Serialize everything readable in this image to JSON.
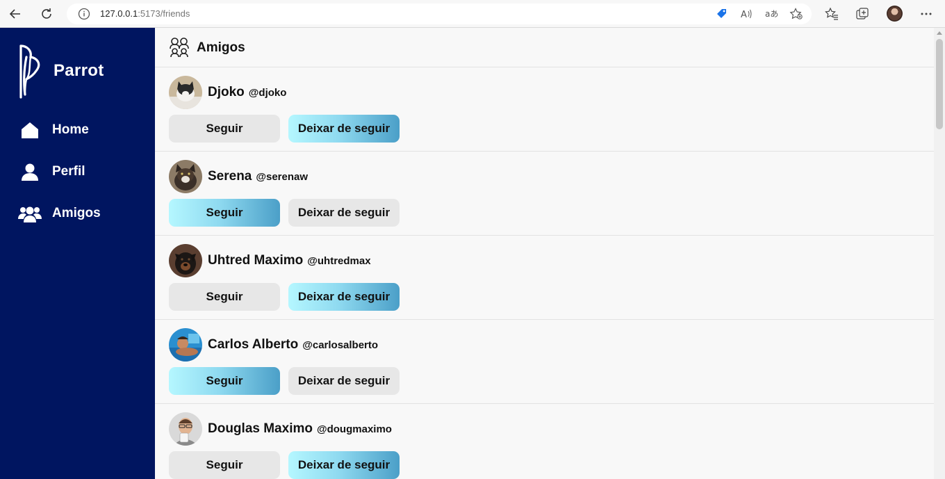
{
  "browser": {
    "url_host": "127.0.0.1",
    "url_path": ":5173/friends"
  },
  "sidebar": {
    "brand": "Parrot",
    "items": [
      {
        "label": "Home",
        "icon": "home-icon"
      },
      {
        "label": "Perfil",
        "icon": "user-icon"
      },
      {
        "label": "Amigos",
        "icon": "users-icon"
      }
    ]
  },
  "main": {
    "title": "Amigos",
    "friends": [
      {
        "name": "Djoko",
        "handle": "@djoko",
        "follow_label": "Seguir",
        "unfollow_label": "Deixar de seguir",
        "highlighted": "unfollow"
      },
      {
        "name": "Serena",
        "handle": "@serenaw",
        "follow_label": "Seguir",
        "unfollow_label": "Deixar de seguir",
        "highlighted": "follow"
      },
      {
        "name": "Uhtred Maximo",
        "handle": "@uhtredmax",
        "follow_label": "Seguir",
        "unfollow_label": "Deixar de seguir",
        "highlighted": "unfollow"
      },
      {
        "name": "Carlos Alberto",
        "handle": "@carlosalberto",
        "follow_label": "Seguir",
        "unfollow_label": "Deixar de seguir",
        "highlighted": "follow"
      },
      {
        "name": "Douglas Maximo",
        "handle": "@dougmaximo",
        "follow_label": "Seguir",
        "unfollow_label": "Deixar de seguir",
        "highlighted": "unfollow"
      }
    ]
  },
  "colors": {
    "sidebar_bg": "#001560",
    "button_gradient_start": "#b5f7ff",
    "button_gradient_end": "#4b9fc8",
    "button_grey": "#e7e7e7"
  }
}
